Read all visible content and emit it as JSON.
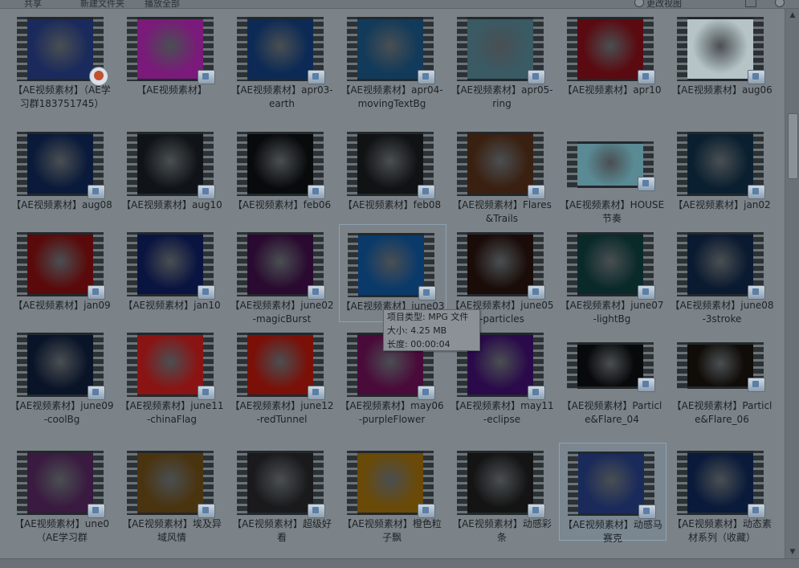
{
  "toolbar": {
    "items": [
      "共享",
      "新建文件夹",
      "播放全部"
    ],
    "view_label": "更改视图"
  },
  "files": [
    {
      "label": "【AE视频素材】（AE学习群183751745）",
      "icon": "video-play-icon",
      "frame": "#1b2a5c"
    },
    {
      "label": "【AE视频素材】",
      "icon": "film-icon",
      "frame": "#7a1a7a"
    },
    {
      "label": "【AE视频素材】apr03-earth",
      "icon": "film-icon",
      "frame": "#0c2a55"
    },
    {
      "label": "【AE视频素材】apr04-movingTextBg",
      "icon": "film-icon",
      "frame": "#123a5a"
    },
    {
      "label": "【AE视频素材】apr05-ring",
      "icon": "film-icon",
      "frame": "#3a5a64"
    },
    {
      "label": "【AE视频素材】apr10",
      "icon": "film-icon",
      "frame": "#5a0a10"
    },
    {
      "label": "【AE视频素材】aug06",
      "icon": "film-icon",
      "frame": "#b6c4c8"
    },
    {
      "label": "【AE视频素材】aug08",
      "icon": "film-icon",
      "frame": "#0a1a3a"
    },
    {
      "label": "【AE视频素材】aug10",
      "icon": "film-icon",
      "frame": "#101418"
    },
    {
      "label": "【AE视频素材】feb06",
      "icon": "film-icon",
      "frame": "#080a0c"
    },
    {
      "label": "【AE视频素材】feb08",
      "icon": "film-icon",
      "frame": "#101214"
    },
    {
      "label": "【AE视频素材】Flares&Trails",
      "icon": "film-icon",
      "frame": "#3a2010"
    },
    {
      "label": "【AE视频素材】HOUSE节奏",
      "icon": "film-icon",
      "frame": "#5a8a94"
    },
    {
      "label": "【AE视频素材】jan02",
      "icon": "film-icon",
      "frame": "#0a2030"
    },
    {
      "label": "【AE视频素材】jan09",
      "icon": "film-icon",
      "frame": "#5a0a0a"
    },
    {
      "label": "【AE视频素材】jan10",
      "icon": "film-icon",
      "frame": "#0a1440"
    },
    {
      "label": "【AE视频素材】june02-magicBurst",
      "icon": "film-icon",
      "frame": "#2a0a30"
    },
    {
      "label": "【AE视频素材】june03-",
      "icon": "film-icon",
      "frame": "#0a3a6a"
    },
    {
      "label": "【AE视频素材】june05-particles",
      "icon": "film-icon",
      "frame": "#1a0c08"
    },
    {
      "label": "【AE视频素材】june07-lightBg",
      "icon": "film-icon",
      "frame": "#0a2a2a"
    },
    {
      "label": "【AE视频素材】june08-3stroke",
      "icon": "film-icon",
      "frame": "#0a1a30"
    },
    {
      "label": "【AE视频素材】june09-coolBg",
      "icon": "film-icon",
      "frame": "#0a1428"
    },
    {
      "label": "【AE视频素材】june11-chinaFlag",
      "icon": "film-icon",
      "frame": "#8a1414"
    },
    {
      "label": "【AE视频素材】june12-redTunnel",
      "icon": "film-icon",
      "frame": "#7a1008"
    },
    {
      "label": "【AE视频素材】may06-purpleFlower",
      "icon": "film-icon",
      "frame": "#4a0a3a"
    },
    {
      "label": "【AE视频素材】may11-eclipse",
      "icon": "film-icon",
      "frame": "#2a0a4a"
    },
    {
      "label": "【AE视频素材】Particle&Flare_04",
      "icon": "film-icon",
      "frame": "#08090a"
    },
    {
      "label": "【AE视频素材】Particle&Flare_06",
      "icon": "film-icon",
      "frame": "#100c08"
    },
    {
      "label": "【AE视频素材】une0（AE学习群",
      "icon": "film-icon",
      "frame": "#3a1a40"
    },
    {
      "label": "【AE视频素材】埃及异域风情",
      "icon": "film-icon",
      "frame": "#4a3410"
    },
    {
      "label": "【AE视频素材】超级好看",
      "icon": "film-icon",
      "frame": "#1a1a1c"
    },
    {
      "label": "【AE视频素材】橙色粒子飘",
      "icon": "film-icon",
      "frame": "#6a4a08"
    },
    {
      "label": "【AE视频素材】动感彩条",
      "icon": "film-icon",
      "frame": "#141414"
    },
    {
      "label": "【AE视频素材】动感马赛克",
      "icon": "film-icon",
      "frame": "#1a2a5a"
    },
    {
      "label": "【AE视频素材】动态素材系列（收藏）",
      "icon": "film-icon",
      "frame": "#0a1a3a"
    }
  ],
  "tooltip": {
    "type": "项目类型: MPG 文件",
    "size": "大小: 4.25 MB",
    "length": "长度: 00:00:04"
  }
}
